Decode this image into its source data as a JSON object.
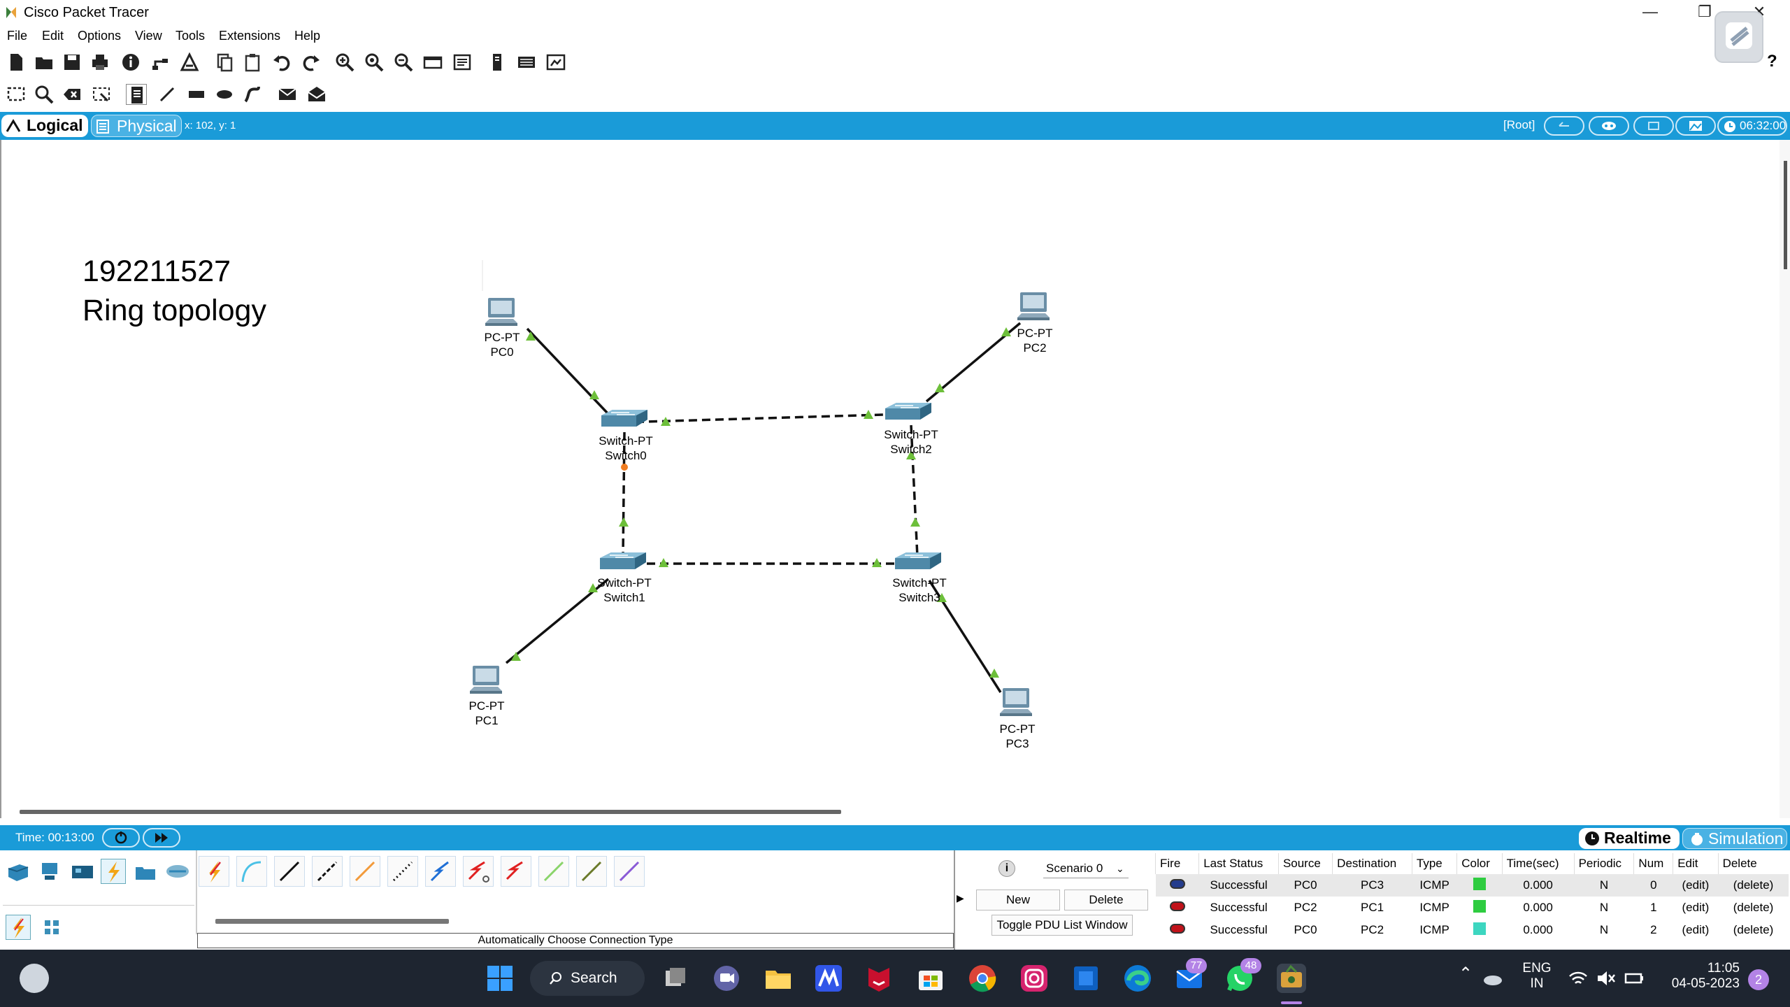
{
  "window": {
    "title": "Cisco Packet Tracer",
    "icons": {
      "app": "packet-tracer-icon",
      "help": "?"
    }
  },
  "menu": [
    "File",
    "Edit",
    "Options",
    "View",
    "Tools",
    "Extensions",
    "Help"
  ],
  "toolbar1": [
    "new-icon",
    "open-icon",
    "save-icon",
    "print-icon",
    "info-icon",
    "network-info-icon",
    "wizard-icon",
    "copy-icon",
    "paste-icon",
    "undo-icon",
    "redo-icon",
    "zoom-in-icon",
    "zoom-reset-icon",
    "zoom-out-icon",
    "drawing-palette-icon",
    "custom-device-icon",
    "viewer-icon",
    "ipc-icon",
    "web-browser-icon"
  ],
  "toolbar2": [
    "select-icon",
    "inspect-icon",
    "delete-icon",
    "resize-icon",
    "note-icon",
    "line-icon",
    "rectangle-icon",
    "ellipse-icon",
    "freeform-icon",
    "simple-pdu-icon",
    "complex-pdu-icon"
  ],
  "workspace_bar": {
    "logical_tab": "Logical",
    "physical_tab": "Physical",
    "coords": "x: 102, y: 1",
    "root": "[Root]",
    "clock": "06:32:00",
    "accent": "#1a9bd8"
  },
  "canvas": {
    "note_line1": "192211527",
    "note_line2": "Ring topology",
    "devices": [
      {
        "id": "pc0",
        "type": "PC-PT",
        "name": "PC0"
      },
      {
        "id": "pc1",
        "type": "PC-PT",
        "name": "PC1"
      },
      {
        "id": "pc2",
        "type": "PC-PT",
        "name": "PC2"
      },
      {
        "id": "pc3",
        "type": "PC-PT",
        "name": "PC3"
      },
      {
        "id": "switch0",
        "type": "Switch-PT",
        "name": "Switch0"
      },
      {
        "id": "switch1",
        "type": "Switch-PT",
        "name": "Switch1"
      },
      {
        "id": "switch2",
        "type": "Switch-PT",
        "name": "Switch2"
      },
      {
        "id": "switch3",
        "type": "Switch-PT",
        "name": "Switch3"
      }
    ],
    "link_status_color": "#6dbf3a",
    "link_blocked_color": "#f07d22"
  },
  "timebar": {
    "time": "Time: 00:13:00",
    "realtime": "Realtime",
    "simulation": "Simulation"
  },
  "device_panel": {
    "categories": [
      "network-devices-icon",
      "end-devices-icon",
      "components-icon",
      "connections-icon",
      "misc-icon",
      "multiuser-icon"
    ],
    "connections": [
      "automatic-connection-icon",
      "console-cable-icon",
      "copper-straight-through-icon",
      "copper-cross-over-icon",
      "fiber-icon",
      "phone-cable-icon",
      "coaxial-icon",
      "serial-dce-icon",
      "serial-dte-icon",
      "octal-cable-icon",
      "iot-custom-cable-icon",
      "usb-cable-icon"
    ],
    "caption": "Automatically Choose Connection Type"
  },
  "scenario_panel": {
    "scenario": "Scenario 0",
    "new": "New",
    "delete": "Delete",
    "toggle": "Toggle PDU List Window"
  },
  "pdu_table": {
    "headers": [
      "Fire",
      "Last Status",
      "Source",
      "Destination",
      "Type",
      "Color",
      "Time(sec)",
      "Periodic",
      "Num",
      "Edit",
      "Delete"
    ],
    "rows": [
      {
        "status": "Successful",
        "source": "PC0",
        "destination": "PC3",
        "type": "ICMP",
        "color": "#2ecc40",
        "time": "0.000",
        "periodic": "N",
        "num": "0",
        "edit": "(edit)",
        "delete": "(delete)"
      },
      {
        "status": "Successful",
        "source": "PC2",
        "destination": "PC1",
        "type": "ICMP",
        "color": "#2ecc40",
        "time": "0.000",
        "periodic": "N",
        "num": "1",
        "edit": "(edit)",
        "delete": "(delete)"
      },
      {
        "status": "Successful",
        "source": "PC0",
        "destination": "PC2",
        "type": "ICMP",
        "color": "#3dd6c0",
        "time": "0.000",
        "periodic": "N",
        "num": "2",
        "edit": "(edit)",
        "delete": "(delete)"
      }
    ]
  },
  "taskbar": {
    "search": "Search",
    "apps": [
      "start-icon",
      "task-view-icon",
      "teams-icon",
      "file-explorer-icon",
      "app-m-icon",
      "mcafee-icon",
      "store-icon",
      "chrome-icon",
      "instagram-icon",
      "app-blue-icon",
      "edge-icon",
      "mail-icon",
      "whatsapp-icon",
      "packet-tracer-icon"
    ],
    "mail_badge": "77",
    "whatsapp_badge": "48",
    "lang1": "ENG",
    "lang2": "IN",
    "time": "11:05",
    "date": "04-05-2023",
    "notifications": "2"
  }
}
